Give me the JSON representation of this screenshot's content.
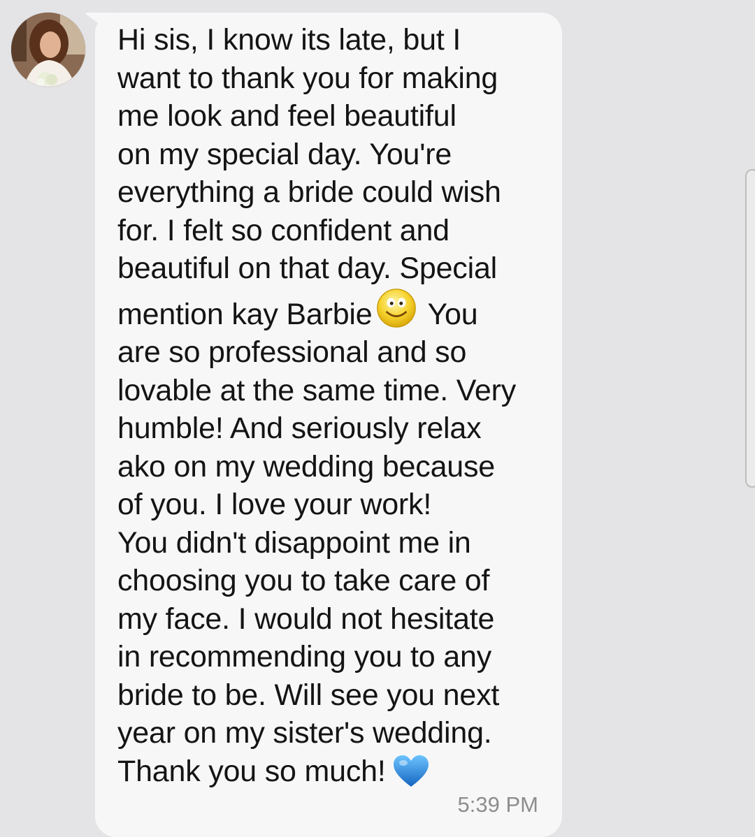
{
  "message": {
    "sender_avatar": "bride-profile-photo",
    "text_before_emoji": "Hi sis, I know its late, but I\nwant to thank you for making\nme look and feel beautiful\non my special day. You're\neverything a bride could wish\nfor. I felt so confident and\nbeautiful on that day. Special\nmention kay Barbie",
    "emoji_1": "smiley-face-emoji",
    "text_after_emoji": " You\nare so professional and so\nlovable at the same time. Very\nhumble! And seriously relax\nako on my wedding because\nof you. I love your work!\nYou didn't disappoint me in\nchoosing you to take care of\nmy face. I would not hesitate\nin recommending you to any\nbride to be. Will see you next\nyear on my sister's wedding.\nThank you so much!",
    "emoji_2": "blue-heart-emoji",
    "timestamp": "5:39 PM"
  },
  "colors": {
    "background": "#e4e4e6",
    "bubble": "#f7f7f7",
    "text": "#141414",
    "timestamp": "#8d8d8d",
    "heart": "#1e88e5"
  }
}
